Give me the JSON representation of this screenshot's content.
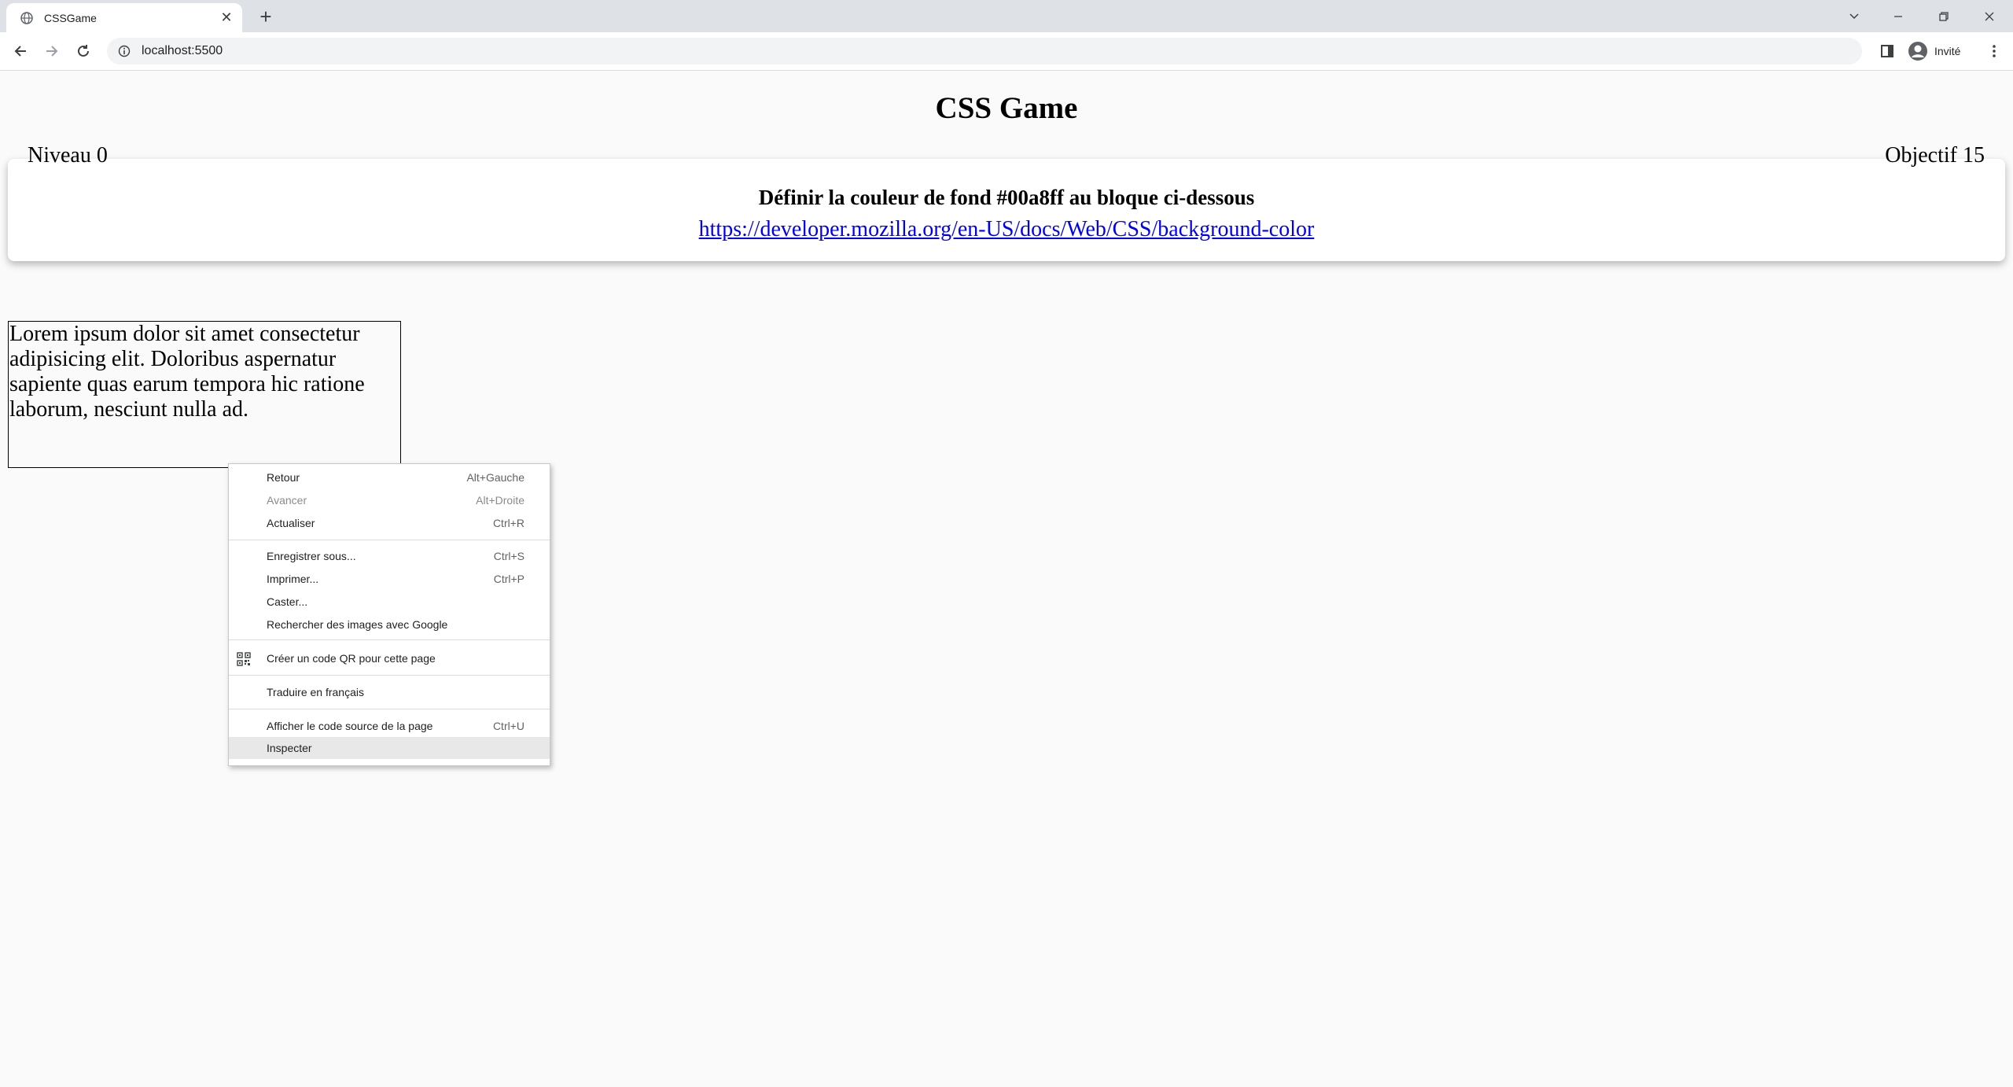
{
  "browser": {
    "tab_title": "CSSGame",
    "tab_close": "✕",
    "new_tab": "+",
    "url": "localhost:5500",
    "profile_label": "Invité",
    "window_controls": [
      "chevron-down-icon",
      "minimize-icon",
      "restore-icon",
      "close-icon"
    ]
  },
  "page": {
    "title": "CSS Game",
    "level": "Niveau 0",
    "objective": "Objectif 15",
    "task_text": "Définir la couleur de fond #00a8ff au bloque ci-dessous",
    "task_link": "https://developer.mozilla.org/en-US/docs/Web/CSS/background-color",
    "target_text": "Lorem ipsum dolor sit amet consectetur adipisicing elit. Doloribus aspernatur sapiente quas earum tempora hic ratione laborum, nesciunt nulla ad."
  },
  "context_menu": {
    "items": [
      {
        "label": "Retour",
        "shortcut": "Alt+Gauche"
      },
      {
        "label": "Avancer",
        "shortcut": "Alt+Droite"
      },
      {
        "label": "Actualiser",
        "shortcut": "Ctrl+R"
      },
      {
        "label": "Enregistrer sous...",
        "shortcut": "Ctrl+S"
      },
      {
        "label": "Imprimer...",
        "shortcut": "Ctrl+P"
      },
      {
        "label": "Caster..."
      },
      {
        "label": "Rechercher des images avec Google"
      },
      {
        "label": "Créer un code QR pour cette page"
      },
      {
        "label": "Traduire en français"
      },
      {
        "label": "Afficher le code source de la page",
        "shortcut": "Ctrl+U"
      },
      {
        "label": "Inspecter"
      }
    ]
  }
}
